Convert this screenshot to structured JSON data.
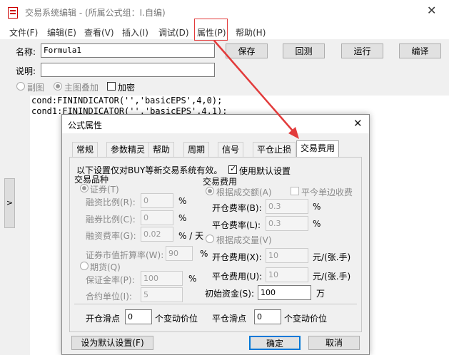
{
  "window": {
    "title": "交易系统编辑 - (所属公式组：I.自编)",
    "close": "✕"
  },
  "menu": [
    "文件(F)",
    "编辑(E)",
    "查看(V)",
    "插入(I)",
    "调试(D)",
    "属性(P)",
    "帮助(H)"
  ],
  "form": {
    "name_label": "名称:",
    "name_value": "Formula1",
    "desc_label": "说明:",
    "desc_value": "",
    "buttons": {
      "save": "保存",
      "back": "回测",
      "run": "运行",
      "compile": "编译"
    },
    "subchart": "副图",
    "main_overlay": "主图叠加",
    "encrypt": "加密"
  },
  "code": [
    "cond:FININDICATOR('','basicEPS',4,0);",
    "cond1:FININDICATOR('','basicEPS',4,1);"
  ],
  "left_handle": ">",
  "dialog": {
    "title": "公式属性",
    "close": "✕",
    "tabs": [
      "常规",
      "参数精灵",
      "帮助",
      "周期",
      "信号",
      "平仓止损",
      "交易费用"
    ],
    "note": "以下设置仅对BUY等新交易系统有效。",
    "use_default": "使用默认设置",
    "trade_kind": "交易品种",
    "securities": "证券(T)",
    "margin_ratio_label": "融资比例(R):",
    "margin_ratio": "0",
    "margin_ratio_unit": "%",
    "short_ratio_label": "融券比例(C):",
    "short_ratio": "0",
    "short_ratio_unit": "%",
    "finance_fee_label": "融资费率(G):",
    "finance_fee": "0.02",
    "finance_fee_unit": "% / 天",
    "discount_label": "证券市值折算率(W):",
    "discount": "90",
    "discount_unit": "%",
    "futures": "期货(Q)",
    "deposit_label": "保证金率(P):",
    "deposit": "100",
    "deposit_unit": "%",
    "contract_label": "合约单位(I):",
    "contract": "5",
    "trade_fee": "交易费用",
    "by_amount": "根据成交额(A)",
    "close_today": "平今单边收费",
    "open_rate_label": "开仓费率(B):",
    "open_rate": "0.3",
    "open_rate_unit": "%",
    "close_rate_label": "平仓费率(L):",
    "close_rate": "0.3",
    "close_rate_unit": "%",
    "by_volume": "根据成交量(V)",
    "open_fee_label": "开仓费用(X):",
    "open_fee": "10",
    "open_fee_unit": "元/(张.手)",
    "close_fee_label": "平仓费用(U):",
    "close_fee": "10",
    "close_fee_unit": "元/(张.手)",
    "init_cap_label": "初始资金(S):",
    "init_cap": "100",
    "init_cap_unit": "万",
    "open_slip_label": "开仓滑点",
    "open_slip": "0",
    "open_slip_unit": "个变动价位",
    "close_slip_label": "平仓滑点",
    "close_slip": "0",
    "close_slip_unit": "个变动价位",
    "set_default": "设为默认设置(F)",
    "ok": "确定",
    "cancel": "取消"
  },
  "colors": {
    "highlight": "#e23b3b"
  }
}
